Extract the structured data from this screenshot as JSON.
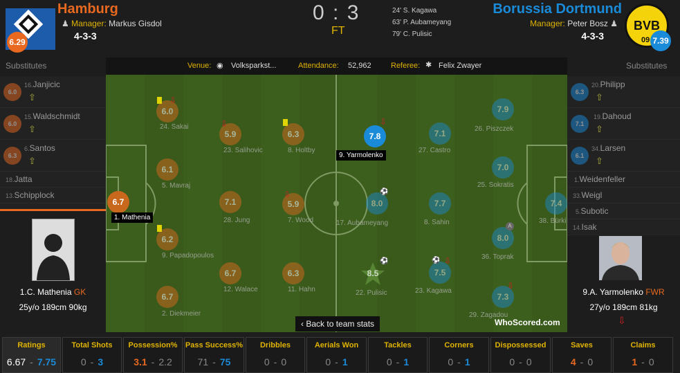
{
  "home": {
    "name": "Hamburg",
    "manager_label": "Manager:",
    "manager": "Markus Gisdol",
    "formation": "4-3-3",
    "rating": "6.29"
  },
  "away": {
    "name": "Borussia Dortmund",
    "manager_label": "Manager:",
    "manager": "Peter Bosz",
    "formation": "4-3-3",
    "rating": "7.39",
    "crest_text": "BVB",
    "crest_sub": "09"
  },
  "score": {
    "value": "0 : 3",
    "status": "FT"
  },
  "goals": [
    "24' S. Kagawa",
    "63' P. Aubameyang",
    "79' C. Pulisic"
  ],
  "infobar": {
    "venue_label": "Venue:",
    "venue": "Volksparkst...",
    "attendance_label": "Attendance:",
    "attendance": "52,962",
    "referee_label": "Referee:",
    "referee": "Felix Zwayer"
  },
  "subs_label": "Substitutes",
  "home_subs": [
    {
      "num": "16.",
      "name": "Janjicic",
      "rating": "6.0"
    },
    {
      "num": "15.",
      "name": "Waldschmidt",
      "rating": "6.0"
    },
    {
      "num": "6.",
      "name": "Santos",
      "rating": "6.3"
    },
    {
      "num": "18.",
      "name": "Jatta",
      "rating": ""
    },
    {
      "num": "13.",
      "name": "Schipplock",
      "rating": ""
    }
  ],
  "away_subs": [
    {
      "num": "20.",
      "name": "Philipp",
      "rating": "6.3"
    },
    {
      "num": "19.",
      "name": "Dahoud",
      "rating": "7.1"
    },
    {
      "num": "34.",
      "name": "Larsen",
      "rating": "6.1"
    },
    {
      "num": "1.",
      "name": "Weidenfeller",
      "rating": ""
    },
    {
      "num": "33.",
      "name": "Weigl",
      "rating": ""
    },
    {
      "num": "5.",
      "name": "Subotic",
      "rating": ""
    },
    {
      "num": "14.",
      "name": "Isak",
      "rating": ""
    }
  ],
  "home_players": [
    {
      "rating": "6.7",
      "label": "1. Mathenia"
    },
    {
      "rating": "6.0",
      "label": "24. Sakai"
    },
    {
      "rating": "6.1",
      "label": "5. Mavraj"
    },
    {
      "rating": "6.2",
      "label": "9. Papadopoulos"
    },
    {
      "rating": "6.7",
      "label": "2. Diekmeier"
    },
    {
      "rating": "5.9",
      "label": "23. Salihovic"
    },
    {
      "rating": "7.1",
      "label": "28. Jung"
    },
    {
      "rating": "6.7",
      "label": "12. Walace"
    },
    {
      "rating": "6.3",
      "label": "8. Holtby"
    },
    {
      "rating": "5.9",
      "label": "7. Wood"
    },
    {
      "rating": "6.3",
      "label": "11. Hahn"
    }
  ],
  "away_players": [
    {
      "rating": "7.8",
      "label": "9. Yarmolenko"
    },
    {
      "rating": "8.0",
      "label": "17. Aubameyang"
    },
    {
      "rating": "8.5",
      "label": "22. Pulisic"
    },
    {
      "rating": "7.1",
      "label": "27. Castro"
    },
    {
      "rating": "7.7",
      "label": "8. Sahin"
    },
    {
      "rating": "7.5",
      "label": "23. Kagawa"
    },
    {
      "rating": "7.9",
      "label": "26. Piszczek"
    },
    {
      "rating": "7.0",
      "label": "25. Sokratis"
    },
    {
      "rating": "8.0",
      "label": "36. Toprak"
    },
    {
      "rating": "7.3",
      "label": "29. Zagadou"
    },
    {
      "rating": "7.4",
      "label": "38. Bürki"
    }
  ],
  "home_card": {
    "name": "1.C. Mathenia",
    "pos": "GK",
    "age": "25y/o",
    "height": "189cm",
    "weight": "90kg"
  },
  "away_card": {
    "name": "9.A. Yarmolenko",
    "pos": "FWR",
    "age": "27y/o",
    "height": "189cm",
    "weight": "81kg"
  },
  "back_link": "Back to team stats",
  "watermark": "WhoScored.com",
  "stats": [
    {
      "label": "Ratings",
      "home": "6.67",
      "away": "7.75",
      "lead": "away"
    },
    {
      "label": "Total Shots",
      "home": "0",
      "away": "3",
      "lead": "away"
    },
    {
      "label": "Possession%",
      "home": "3.1",
      "away": "2.2",
      "lead": "home"
    },
    {
      "label": "Pass Success%",
      "home": "71",
      "away": "75",
      "lead": "away"
    },
    {
      "label": "Dribbles",
      "home": "0",
      "away": "0",
      "lead": "none"
    },
    {
      "label": "Aerials Won",
      "home": "0",
      "away": "1",
      "lead": "away"
    },
    {
      "label": "Tackles",
      "home": "0",
      "away": "1",
      "lead": "away"
    },
    {
      "label": "Corners",
      "home": "0",
      "away": "1",
      "lead": "away"
    },
    {
      "label": "Dispossessed",
      "home": "0",
      "away": "0",
      "lead": "none"
    },
    {
      "label": "Saves",
      "home": "4",
      "away": "0",
      "lead": "home"
    },
    {
      "label": "Claims",
      "home": "1",
      "away": "0",
      "lead": "home"
    }
  ],
  "stat_sep": "-",
  "colors": {
    "home": "#e8691f",
    "away": "#1a8bd9",
    "accent": "#e0b400"
  }
}
